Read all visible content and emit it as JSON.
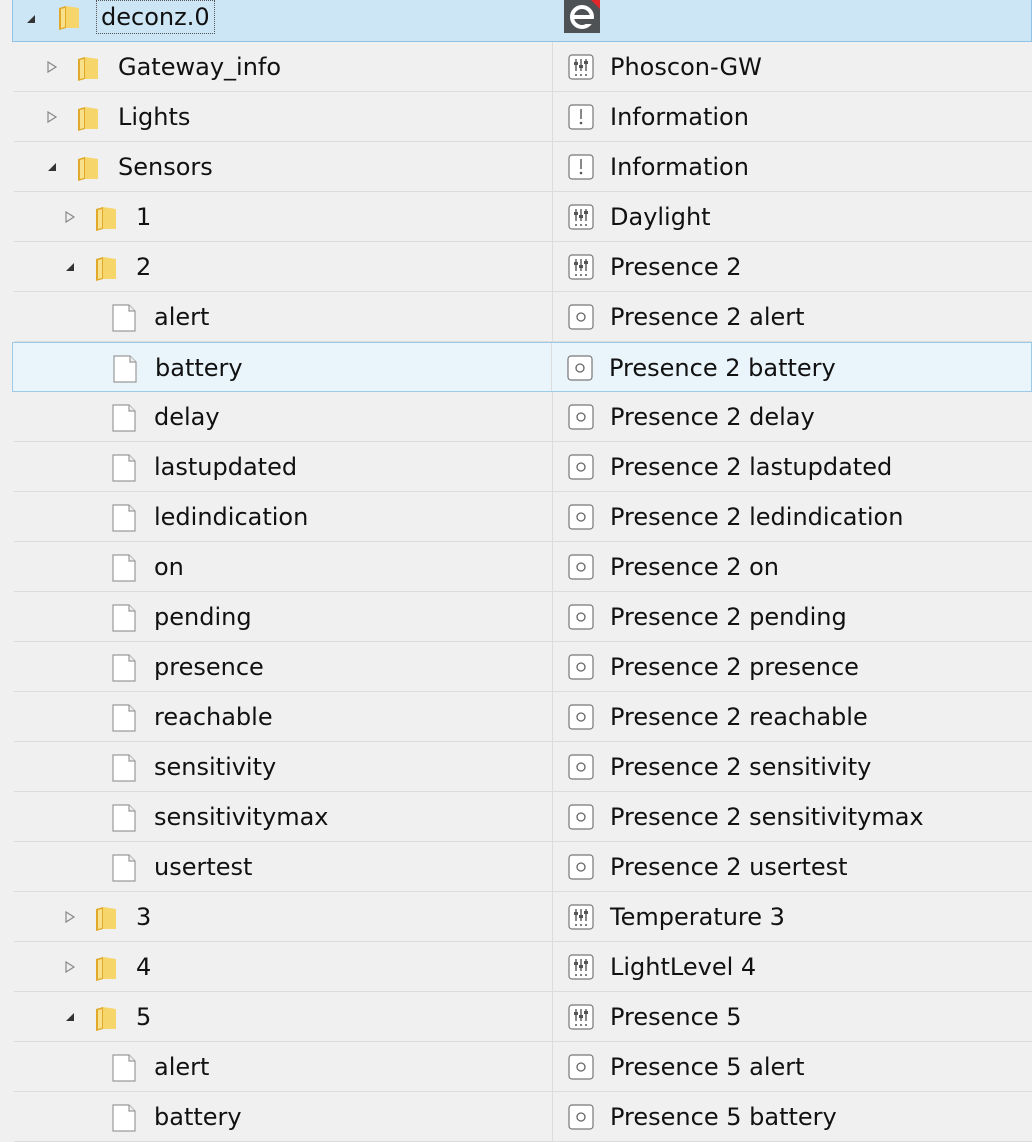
{
  "root": {
    "label": "deconz.0",
    "logo": "iobroker-e-logo-icon"
  },
  "rows": [
    {
      "label": "Gateway_info",
      "type_label": "Phoscon-GW",
      "kind": "folder",
      "level": 1,
      "expander": "collapsed",
      "type_icon": "device"
    },
    {
      "label": "Lights",
      "type_label": "Information",
      "kind": "folder",
      "level": 1,
      "expander": "collapsed",
      "type_icon": "info"
    },
    {
      "label": "Sensors",
      "type_label": "Information",
      "kind": "folder",
      "level": 1,
      "expander": "expanded",
      "type_icon": "info"
    },
    {
      "label": "1",
      "type_label": "Daylight",
      "kind": "folder",
      "level": 2,
      "expander": "collapsed",
      "type_icon": "device"
    },
    {
      "label": "2",
      "type_label": "Presence 2",
      "kind": "folder",
      "level": 2,
      "expander": "expanded",
      "type_icon": "device"
    },
    {
      "label": "alert",
      "type_label": "Presence 2 alert",
      "kind": "file",
      "level": 3,
      "expander": "none",
      "type_icon": "state"
    },
    {
      "label": "battery",
      "type_label": "Presence 2 battery",
      "kind": "file",
      "level": 3,
      "expander": "none",
      "type_icon": "state",
      "selected": true
    },
    {
      "label": "delay",
      "type_label": "Presence 2 delay",
      "kind": "file",
      "level": 3,
      "expander": "none",
      "type_icon": "state"
    },
    {
      "label": "lastupdated",
      "type_label": "Presence 2 lastupdated",
      "kind": "file",
      "level": 3,
      "expander": "none",
      "type_icon": "state"
    },
    {
      "label": "ledindication",
      "type_label": "Presence 2 ledindication",
      "kind": "file",
      "level": 3,
      "expander": "none",
      "type_icon": "state"
    },
    {
      "label": "on",
      "type_label": "Presence 2 on",
      "kind": "file",
      "level": 3,
      "expander": "none",
      "type_icon": "state"
    },
    {
      "label": "pending",
      "type_label": "Presence 2 pending",
      "kind": "file",
      "level": 3,
      "expander": "none",
      "type_icon": "state"
    },
    {
      "label": "presence",
      "type_label": "Presence 2 presence",
      "kind": "file",
      "level": 3,
      "expander": "none",
      "type_icon": "state"
    },
    {
      "label": "reachable",
      "type_label": "Presence 2 reachable",
      "kind": "file",
      "level": 3,
      "expander": "none",
      "type_icon": "state"
    },
    {
      "label": "sensitivity",
      "type_label": "Presence 2 sensitivity",
      "kind": "file",
      "level": 3,
      "expander": "none",
      "type_icon": "state"
    },
    {
      "label": "sensitivitymax",
      "type_label": "Presence 2 sensitivitymax",
      "kind": "file",
      "level": 3,
      "expander": "none",
      "type_icon": "state"
    },
    {
      "label": "usertest",
      "type_label": "Presence 2 usertest",
      "kind": "file",
      "level": 3,
      "expander": "none",
      "type_icon": "state"
    },
    {
      "label": "3",
      "type_label": "Temperature 3",
      "kind": "folder",
      "level": 2,
      "expander": "collapsed",
      "type_icon": "device"
    },
    {
      "label": "4",
      "type_label": "LightLevel 4",
      "kind": "folder",
      "level": 2,
      "expander": "collapsed",
      "type_icon": "device"
    },
    {
      "label": "5",
      "type_label": "Presence 5",
      "kind": "folder",
      "level": 2,
      "expander": "expanded",
      "type_icon": "device"
    },
    {
      "label": "alert",
      "type_label": "Presence 5 alert",
      "kind": "file",
      "level": 3,
      "expander": "none",
      "type_icon": "state"
    },
    {
      "label": "battery",
      "type_label": "Presence 5 battery",
      "kind": "file",
      "level": 3,
      "expander": "none",
      "type_icon": "state"
    }
  ],
  "colors": {
    "root_bg": "#cde6f5",
    "selected_bg": "#e9f4fb",
    "folder": "#f3c84a",
    "row_bg": "#f0f0f0"
  }
}
